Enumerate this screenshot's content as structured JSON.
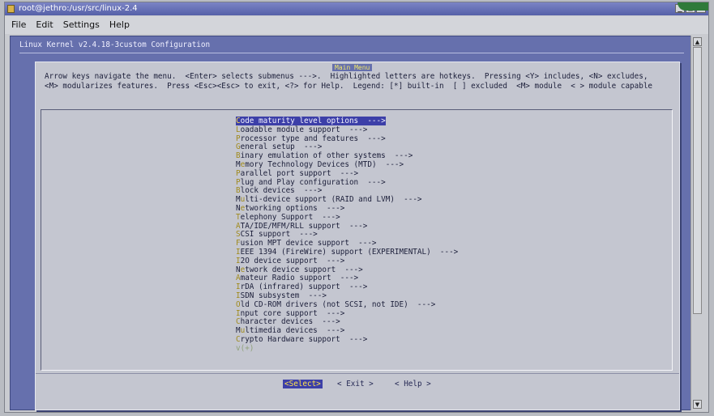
{
  "window": {
    "title": "root@jethro:/usr/src/linux-2.4",
    "buttons": [
      "_",
      "□",
      "X"
    ]
  },
  "menubar": {
    "items": [
      "File",
      "Edit",
      "Settings",
      "Help"
    ]
  },
  "terminal": {
    "header": "Linux Kernel v2.4.18-3custom Configuration",
    "dialog_title": "Main Menu",
    "help_line_1": "Arrow keys navigate the menu.  <Enter> selects submenus --->.  Highlighted letters are hotkeys.  Pressing <Y> includes, <N> excludes,",
    "help_line_2": "<M> modularizes features.  Press <Esc><Esc> to exit, <?> for Help.  Legend: [*] built-in  [ ] excluded  <M> module  < > module capable",
    "menu_items": [
      {
        "hot": "C",
        "text": "ode maturity level options  --->"
      },
      {
        "hot": "L",
        "text": "oadable module support  --->"
      },
      {
        "hot": "P",
        "text": "rocessor type and features  --->"
      },
      {
        "hot": "G",
        "text": "eneral setup  --->"
      },
      {
        "hot": "B",
        "text": "inary emulation of other systems  --->"
      },
      {
        "pre": "M",
        "hot": "e",
        "text": "mory Technology Devices (MTD)  --->"
      },
      {
        "hot": "P",
        "text": "arallel port support  --->"
      },
      {
        "hot": "P",
        "text": "lug and Play configuration  --->"
      },
      {
        "hot": "B",
        "text": "lock devices  --->"
      },
      {
        "pre": "M",
        "hot": "u",
        "text": "lti-device support (RAID and LVM)  --->"
      },
      {
        "pre": "N",
        "hot": "e",
        "text": "tworking options  --->"
      },
      {
        "hot": "T",
        "text": "elephony Support  --->"
      },
      {
        "hot": "A",
        "text": "TA/IDE/MFM/RLL support  --->"
      },
      {
        "hot": "S",
        "text": "CSI support  --->"
      },
      {
        "hot": "F",
        "text": "usion MPT device support  --->"
      },
      {
        "hot": "I",
        "text": "EEE 1394 (FireWire) support (EXPERIMENTAL)  --->"
      },
      {
        "hot": "I",
        "text": "2O device support  --->"
      },
      {
        "pre": "N",
        "hot": "e",
        "text": "twork device support  --->"
      },
      {
        "hot": "A",
        "text": "mateur Radio support  --->"
      },
      {
        "hot": "I",
        "text": "rDA (infrared) support  --->"
      },
      {
        "hot": "I",
        "text": "SDN subsystem  --->"
      },
      {
        "hot": "O",
        "text": "ld CD-ROM drivers (not SCSI, not IDE)  --->"
      },
      {
        "hot": "I",
        "text": "nput core support  --->"
      },
      {
        "hot": "C",
        "text": "haracter devices  --->"
      },
      {
        "pre": "M",
        "hot": "u",
        "text": "ltimedia devices  --->"
      },
      {
        "hot": "C",
        "text": "rypto Hardware support  --->"
      }
    ],
    "more_indicator": "v(+)",
    "buttons": {
      "select": "<Select>",
      "exit": "< Exit >",
      "help": "< Help >"
    }
  },
  "colors": {
    "terminal_bg": "#6670ad",
    "dialog_bg": "#c4c6d0",
    "selection_bg": "#3c3fa8",
    "hotkey": "#a08a1c",
    "title_accent": "#f0e66b"
  }
}
